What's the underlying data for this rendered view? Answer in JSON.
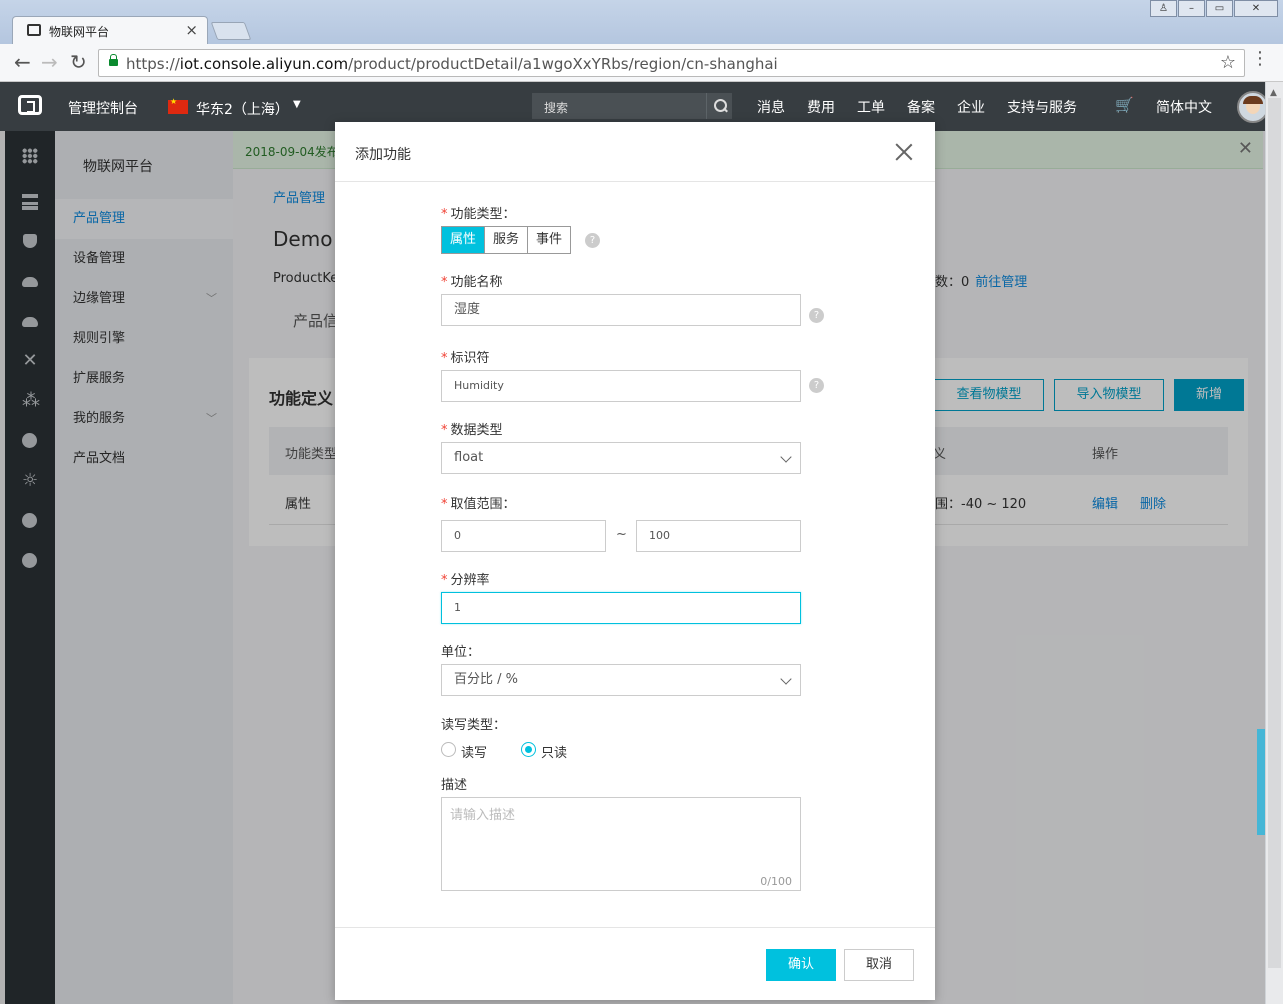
{
  "browser": {
    "tab_title": "物联网平台",
    "url_prefix": "https://",
    "url_host": "iot.console.aliyun.com",
    "url_path": "/product/productDetail/a1wgoXxYRbs/region/cn-shanghai"
  },
  "topbar": {
    "title": "管理控制台",
    "region": "华东2（上海）",
    "search_placeholder": "搜索",
    "nav": [
      "消息",
      "费用",
      "工单",
      "备案",
      "企业",
      "支持与服务"
    ],
    "language": "简体中文"
  },
  "sidebar": {
    "title": "物联网平台",
    "items": [
      {
        "label": "产品管理"
      },
      {
        "label": "设备管理"
      },
      {
        "label": "边缘管理"
      },
      {
        "label": "规则引擎"
      },
      {
        "label": "扩展服务"
      },
      {
        "label": "我的服务"
      },
      {
        "label": "产品文档"
      }
    ]
  },
  "main": {
    "notice": "2018-09-04发布公",
    "breadcrumb": "产品管理",
    "product_name": "Demo",
    "product_key_label": "ProductKe",
    "device_count": "数：0",
    "manage_link": "前往管理",
    "tab": "产品信",
    "card_title": "功能定义",
    "buttons": {
      "view_model": "查看物模型",
      "import_model": "导入物模型",
      "add": "新增"
    },
    "table": {
      "headers": [
        "功能类型",
        "义",
        "操作"
      ],
      "row": {
        "type": "属性",
        "definition": "围：-40 ~ 120",
        "edit": "编辑",
        "delete": "删除"
      }
    }
  },
  "modal": {
    "title": "添加功能",
    "func_type": {
      "label": "功能类型：",
      "options": [
        "属性",
        "服务",
        "事件"
      ],
      "selected": "属性"
    },
    "func_name": {
      "label": "功能名称",
      "value": "湿度"
    },
    "identifier": {
      "label": "标识符",
      "value": "Humidity"
    },
    "data_type": {
      "label": "数据类型",
      "value": "float"
    },
    "range": {
      "label": "取值范围：",
      "min": "0",
      "separator": "~",
      "max": "100"
    },
    "resolution": {
      "label": "分辨率",
      "value": "1"
    },
    "unit": {
      "label": "单位：",
      "value": "百分比 / %"
    },
    "rw": {
      "label": "读写类型：",
      "options": [
        "读写",
        "只读"
      ],
      "selected": "只读"
    },
    "description": {
      "label": "描述",
      "placeholder": "请输入描述",
      "counter": "0/100"
    },
    "confirm": "确认",
    "cancel": "取消"
  }
}
